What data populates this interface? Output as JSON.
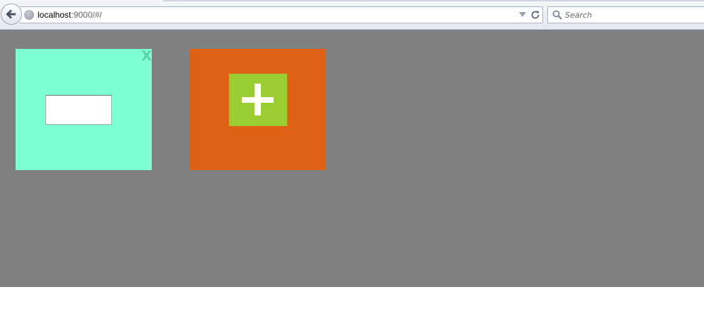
{
  "browser": {
    "url_host": "localhost",
    "url_rest": ":9000/#/",
    "search_placeholder": "Search"
  },
  "page": {
    "background": "#808080",
    "note_card": {
      "color": "#7fffd4",
      "close_label": "X",
      "input_value": ""
    },
    "add_card": {
      "color": "#de6116",
      "button_color": "#9acd32",
      "button_icon": "plus-icon"
    }
  }
}
